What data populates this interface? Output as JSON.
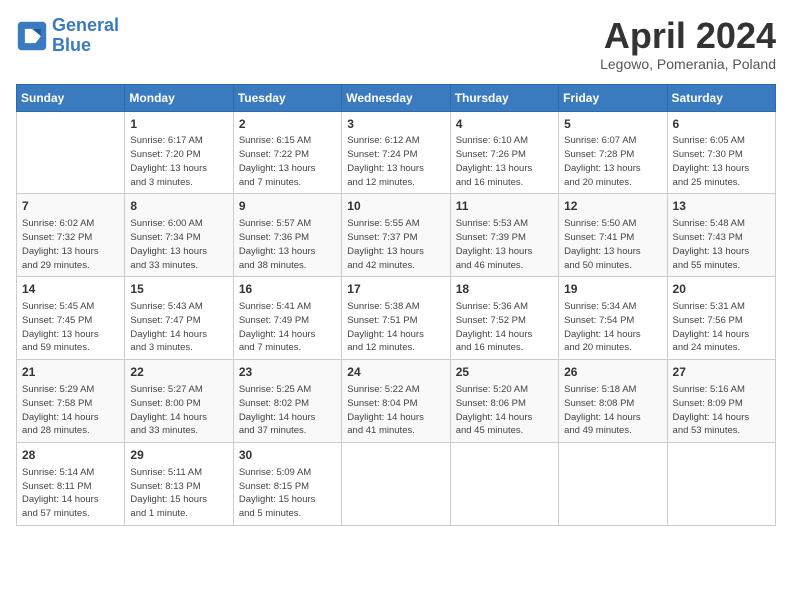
{
  "header": {
    "logo_line1": "General",
    "logo_line2": "Blue",
    "month_title": "April 2024",
    "location": "Legowo, Pomerania, Poland"
  },
  "weekdays": [
    "Sunday",
    "Monday",
    "Tuesday",
    "Wednesday",
    "Thursday",
    "Friday",
    "Saturday"
  ],
  "weeks": [
    [
      {
        "day": "",
        "info": ""
      },
      {
        "day": "1",
        "info": "Sunrise: 6:17 AM\nSunset: 7:20 PM\nDaylight: 13 hours\nand 3 minutes."
      },
      {
        "day": "2",
        "info": "Sunrise: 6:15 AM\nSunset: 7:22 PM\nDaylight: 13 hours\nand 7 minutes."
      },
      {
        "day": "3",
        "info": "Sunrise: 6:12 AM\nSunset: 7:24 PM\nDaylight: 13 hours\nand 12 minutes."
      },
      {
        "day": "4",
        "info": "Sunrise: 6:10 AM\nSunset: 7:26 PM\nDaylight: 13 hours\nand 16 minutes."
      },
      {
        "day": "5",
        "info": "Sunrise: 6:07 AM\nSunset: 7:28 PM\nDaylight: 13 hours\nand 20 minutes."
      },
      {
        "day": "6",
        "info": "Sunrise: 6:05 AM\nSunset: 7:30 PM\nDaylight: 13 hours\nand 25 minutes."
      }
    ],
    [
      {
        "day": "7",
        "info": "Sunrise: 6:02 AM\nSunset: 7:32 PM\nDaylight: 13 hours\nand 29 minutes."
      },
      {
        "day": "8",
        "info": "Sunrise: 6:00 AM\nSunset: 7:34 PM\nDaylight: 13 hours\nand 33 minutes."
      },
      {
        "day": "9",
        "info": "Sunrise: 5:57 AM\nSunset: 7:36 PM\nDaylight: 13 hours\nand 38 minutes."
      },
      {
        "day": "10",
        "info": "Sunrise: 5:55 AM\nSunset: 7:37 PM\nDaylight: 13 hours\nand 42 minutes."
      },
      {
        "day": "11",
        "info": "Sunrise: 5:53 AM\nSunset: 7:39 PM\nDaylight: 13 hours\nand 46 minutes."
      },
      {
        "day": "12",
        "info": "Sunrise: 5:50 AM\nSunset: 7:41 PM\nDaylight: 13 hours\nand 50 minutes."
      },
      {
        "day": "13",
        "info": "Sunrise: 5:48 AM\nSunset: 7:43 PM\nDaylight: 13 hours\nand 55 minutes."
      }
    ],
    [
      {
        "day": "14",
        "info": "Sunrise: 5:45 AM\nSunset: 7:45 PM\nDaylight: 13 hours\nand 59 minutes."
      },
      {
        "day": "15",
        "info": "Sunrise: 5:43 AM\nSunset: 7:47 PM\nDaylight: 14 hours\nand 3 minutes."
      },
      {
        "day": "16",
        "info": "Sunrise: 5:41 AM\nSunset: 7:49 PM\nDaylight: 14 hours\nand 7 minutes."
      },
      {
        "day": "17",
        "info": "Sunrise: 5:38 AM\nSunset: 7:51 PM\nDaylight: 14 hours\nand 12 minutes."
      },
      {
        "day": "18",
        "info": "Sunrise: 5:36 AM\nSunset: 7:52 PM\nDaylight: 14 hours\nand 16 minutes."
      },
      {
        "day": "19",
        "info": "Sunrise: 5:34 AM\nSunset: 7:54 PM\nDaylight: 14 hours\nand 20 minutes."
      },
      {
        "day": "20",
        "info": "Sunrise: 5:31 AM\nSunset: 7:56 PM\nDaylight: 14 hours\nand 24 minutes."
      }
    ],
    [
      {
        "day": "21",
        "info": "Sunrise: 5:29 AM\nSunset: 7:58 PM\nDaylight: 14 hours\nand 28 minutes."
      },
      {
        "day": "22",
        "info": "Sunrise: 5:27 AM\nSunset: 8:00 PM\nDaylight: 14 hours\nand 33 minutes."
      },
      {
        "day": "23",
        "info": "Sunrise: 5:25 AM\nSunset: 8:02 PM\nDaylight: 14 hours\nand 37 minutes."
      },
      {
        "day": "24",
        "info": "Sunrise: 5:22 AM\nSunset: 8:04 PM\nDaylight: 14 hours\nand 41 minutes."
      },
      {
        "day": "25",
        "info": "Sunrise: 5:20 AM\nSunset: 8:06 PM\nDaylight: 14 hours\nand 45 minutes."
      },
      {
        "day": "26",
        "info": "Sunrise: 5:18 AM\nSunset: 8:08 PM\nDaylight: 14 hours\nand 49 minutes."
      },
      {
        "day": "27",
        "info": "Sunrise: 5:16 AM\nSunset: 8:09 PM\nDaylight: 14 hours\nand 53 minutes."
      }
    ],
    [
      {
        "day": "28",
        "info": "Sunrise: 5:14 AM\nSunset: 8:11 PM\nDaylight: 14 hours\nand 57 minutes."
      },
      {
        "day": "29",
        "info": "Sunrise: 5:11 AM\nSunset: 8:13 PM\nDaylight: 15 hours\nand 1 minute."
      },
      {
        "day": "30",
        "info": "Sunrise: 5:09 AM\nSunset: 8:15 PM\nDaylight: 15 hours\nand 5 minutes."
      },
      {
        "day": "",
        "info": ""
      },
      {
        "day": "",
        "info": ""
      },
      {
        "day": "",
        "info": ""
      },
      {
        "day": "",
        "info": ""
      }
    ]
  ]
}
